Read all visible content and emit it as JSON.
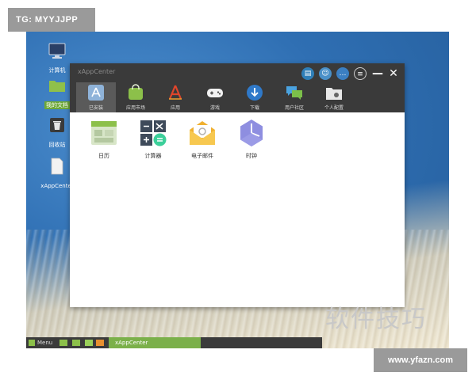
{
  "badges": {
    "telegram": "TG: MYYJJPP",
    "site": "www.yfazn.com"
  },
  "watermark": "软件技巧",
  "desktop": {
    "icons": [
      {
        "label": "计算机",
        "icon": "monitor-icon"
      },
      {
        "label": "我的文档",
        "icon": "folder-icon",
        "selected": true
      },
      {
        "label": "回收站",
        "icon": "recycle-bin-icon"
      },
      {
        "label": "xAppCenter",
        "icon": "file-icon"
      }
    ]
  },
  "window": {
    "title": "xAppCenter",
    "controls": {
      "minimize": "—",
      "close": "✕"
    },
    "tabs": [
      {
        "label": "已安装",
        "icon": "app-store-icon"
      },
      {
        "label": "应用市场",
        "icon": "market-bag-icon"
      },
      {
        "label": "应用",
        "icon": "apps-icon"
      },
      {
        "label": "游戏",
        "icon": "gamepad-icon"
      },
      {
        "label": "下载",
        "icon": "download-icon"
      },
      {
        "label": "用户社区",
        "icon": "chat-bubbles-icon"
      },
      {
        "label": "个人配置",
        "icon": "folder-settings-icon"
      }
    ],
    "apps": [
      {
        "label": "日历",
        "icon": "calendar-icon"
      },
      {
        "label": "计算器",
        "icon": "calculator-icon"
      },
      {
        "label": "电子邮件",
        "icon": "mail-icon"
      },
      {
        "label": "时钟",
        "icon": "clock-icon"
      }
    ]
  },
  "taskbar": {
    "menu": "Menu",
    "active_task": "xAppCenter"
  },
  "colors": {
    "titlebar": "#3a3a3a",
    "taskbar": "#3b3b3b",
    "active_task": "#7bb04a",
    "accent_green": "#6ea838"
  }
}
